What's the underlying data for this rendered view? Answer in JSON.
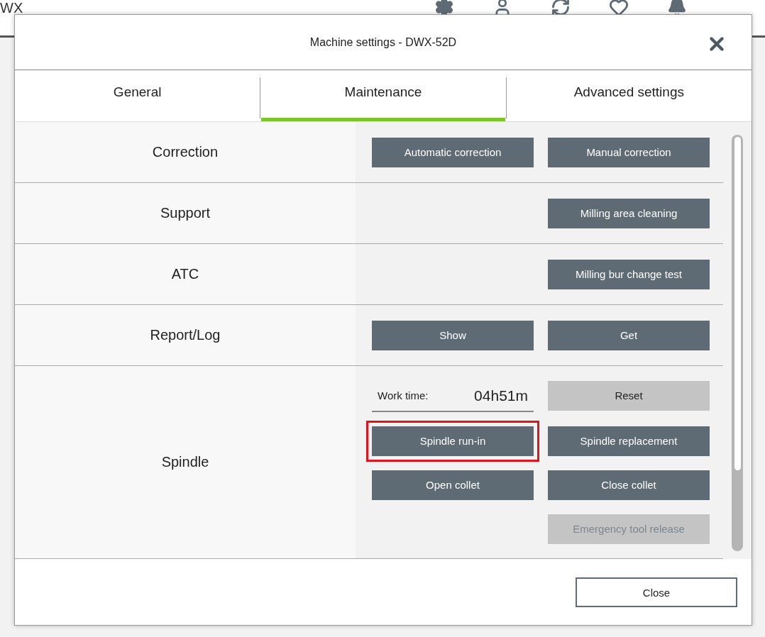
{
  "app_bar": {
    "title": "WX"
  },
  "dialog": {
    "title": "Machine settings - DWX-52D",
    "tabs": [
      {
        "label": "General",
        "selected": false
      },
      {
        "label": "Maintenance",
        "selected": true
      },
      {
        "label": "Advanced settings",
        "selected": false
      }
    ],
    "sections": [
      {
        "label": "Correction",
        "slots": [
          {
            "kind": "button",
            "label": "Automatic correction",
            "disabled": false,
            "light": false,
            "highlighted": false
          },
          {
            "kind": "button",
            "label": "Manual correction",
            "disabled": false,
            "light": false,
            "highlighted": false
          }
        ]
      },
      {
        "label": "Support",
        "slots": [
          {
            "kind": "empty"
          },
          {
            "kind": "button",
            "label": "Milling area cleaning",
            "disabled": false,
            "light": false,
            "highlighted": false
          }
        ]
      },
      {
        "label": "ATC",
        "slots": [
          {
            "kind": "empty"
          },
          {
            "kind": "button",
            "label": "Milling bur change test",
            "disabled": false,
            "light": false,
            "highlighted": false
          }
        ]
      },
      {
        "label": "Report/Log",
        "slots": [
          {
            "kind": "button",
            "label": "Show",
            "disabled": false,
            "light": false,
            "highlighted": false
          },
          {
            "kind": "button",
            "label": "Get",
            "disabled": false,
            "light": false,
            "highlighted": false
          }
        ]
      },
      {
        "label": "Spindle",
        "slots": [
          {
            "kind": "reading",
            "label": "Work time:",
            "value": "04h51m"
          },
          {
            "kind": "button",
            "label": "Reset",
            "disabled": false,
            "light": true,
            "highlighted": false
          },
          {
            "kind": "button",
            "label": "Spindle run-in",
            "disabled": false,
            "light": false,
            "highlighted": true
          },
          {
            "kind": "button",
            "label": "Spindle replacement",
            "disabled": false,
            "light": false,
            "highlighted": false
          },
          {
            "kind": "button",
            "label": "Open collet",
            "disabled": false,
            "light": false,
            "highlighted": false
          },
          {
            "kind": "button",
            "label": "Close collet",
            "disabled": false,
            "light": false,
            "highlighted": false
          },
          {
            "kind": "empty"
          },
          {
            "kind": "button",
            "label": "Emergency tool release",
            "disabled": true,
            "light": true,
            "highlighted": false
          }
        ]
      }
    ],
    "close_button": "Close"
  }
}
